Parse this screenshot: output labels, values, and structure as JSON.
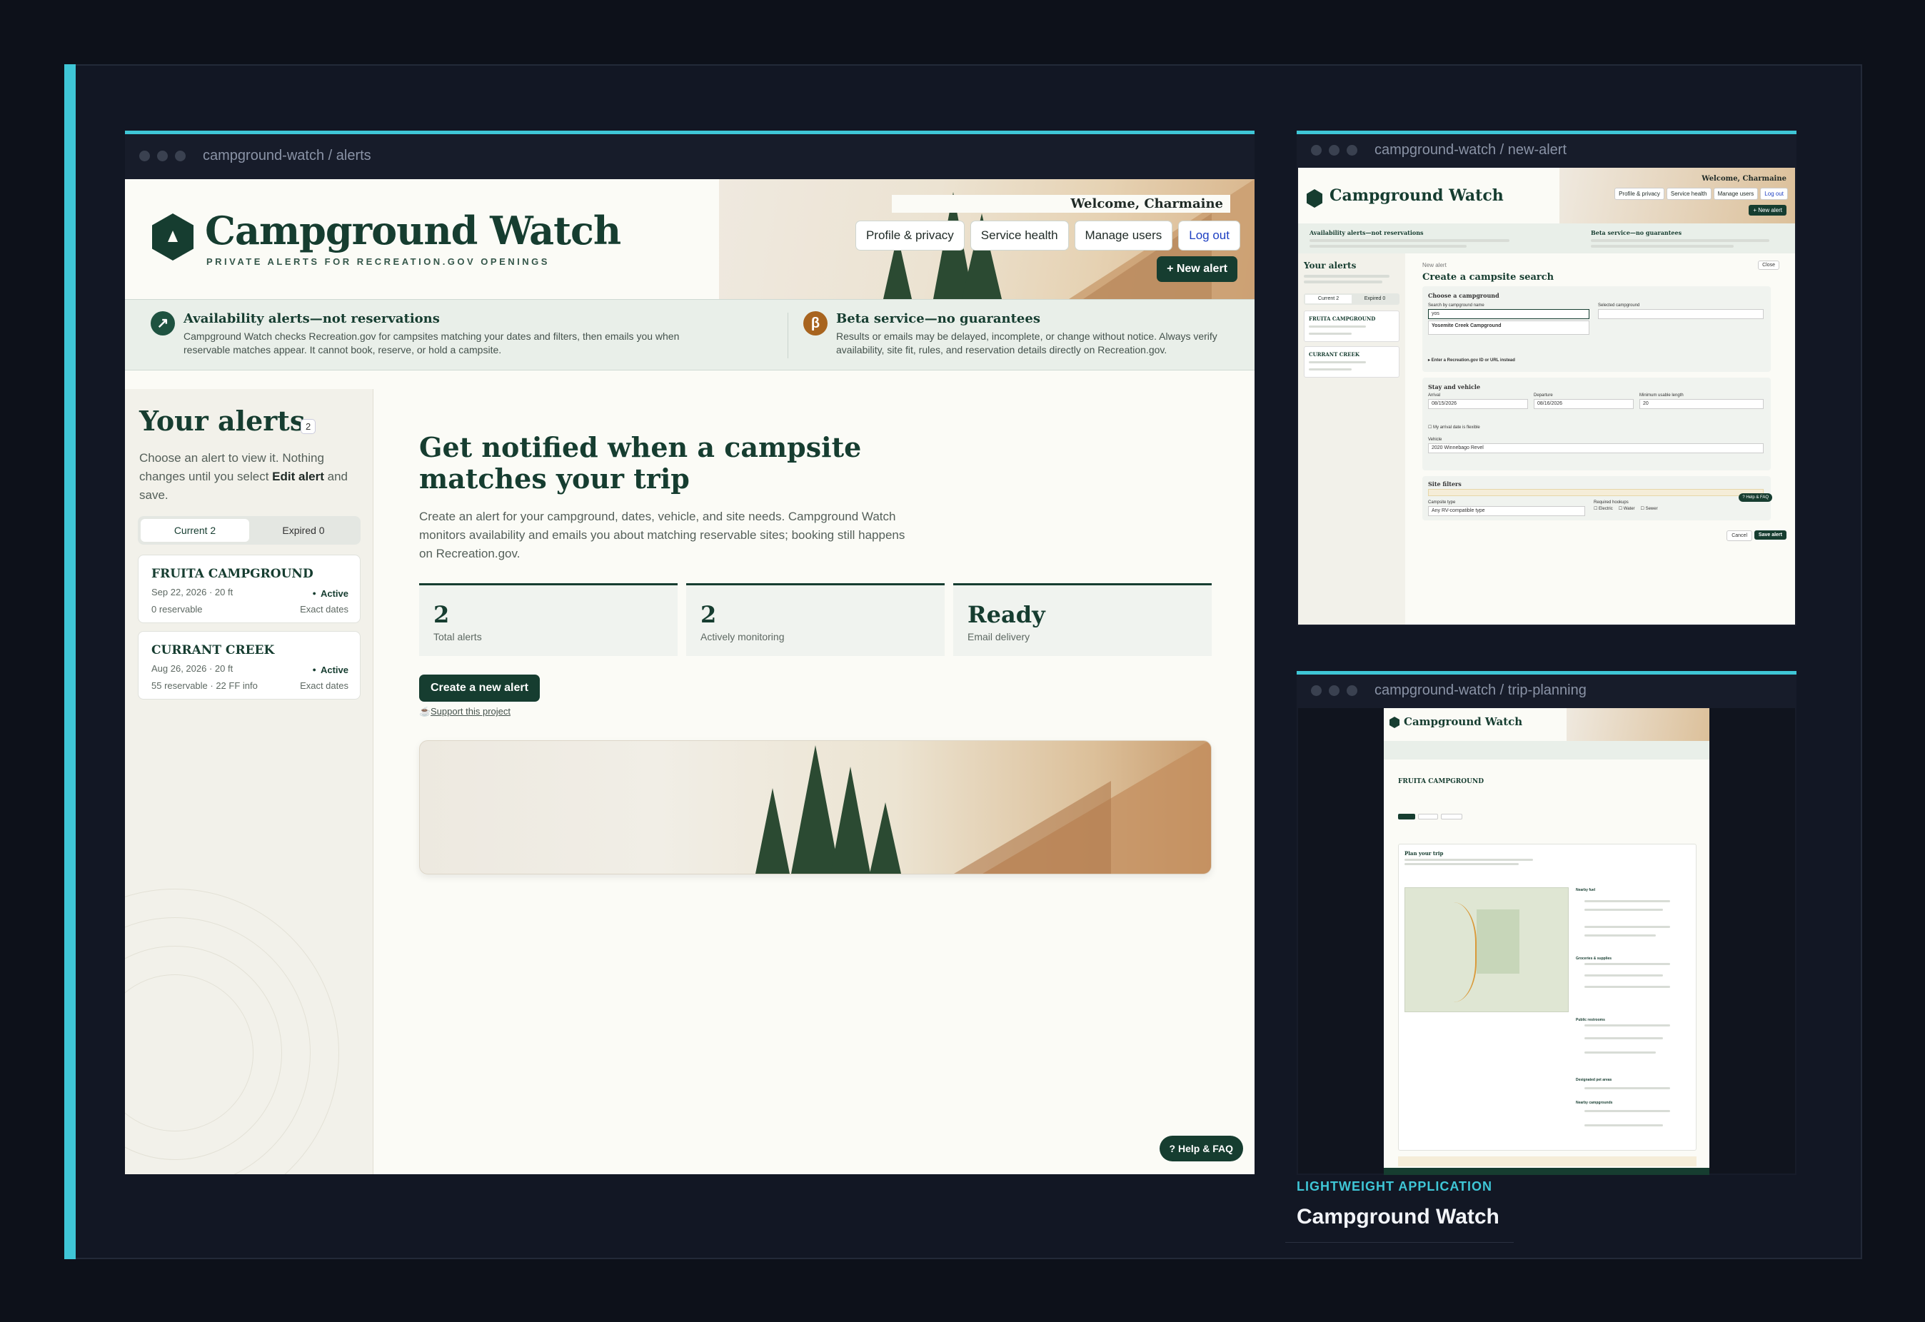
{
  "main_window": {
    "path": "campground-watch / alerts",
    "brand": {
      "title": "Campground Watch",
      "subtitle": "PRIVATE ALERTS FOR RECREATION.GOV OPENINGS"
    },
    "welcome": "Welcome, Charmaine",
    "nav": [
      "Profile & privacy",
      "Service health",
      "Manage users",
      "Log out"
    ],
    "new_alert": "+ New alert",
    "notices": [
      {
        "icon": "↗",
        "title": "Availability alerts—not reservations",
        "text": "Campground Watch checks Recreation.gov for campsites matching your dates and filters, then emails you when reservable matches appear. It cannot book, reserve, or hold a campsite."
      },
      {
        "icon": "β",
        "title": "Beta service—no guarantees",
        "text": "Results or emails may be delayed, incomplete, or change without notice. Always verify availability, site fit, rules, and reservation details directly on Recreation.gov."
      }
    ],
    "sidebar": {
      "title": "Your alerts",
      "count": "2",
      "help_pre": "Choose an alert to view it. Nothing changes until you select ",
      "help_bold": "Edit alert",
      "help_post": " and save.",
      "tabs": [
        "Current 2",
        "Expired 0"
      ],
      "alerts": [
        {
          "name": "FRUITA CAMPGROUND",
          "meta": "Sep 22, 2026 · 20 ft",
          "meta2": "0 reservable",
          "status": "Active",
          "mode": "Exact dates"
        },
        {
          "name": "CURRANT CREEK",
          "meta": "Aug 26, 2026 · 20 ft",
          "meta2": "55 reservable · 22 FF info",
          "status": "Active",
          "mode": "Exact dates"
        }
      ]
    },
    "main": {
      "heading": "Get notified when a campsite matches your trip",
      "lead": "Create an alert for your campground, dates, vehicle, and site needs. Campground Watch monitors availability and emails you about matching reservable sites; booking still happens on Recreation.gov.",
      "stats": [
        {
          "value": "2",
          "label": "Total alerts"
        },
        {
          "value": "2",
          "label": "Actively monitoring"
        },
        {
          "value": "Ready",
          "label": "Email delivery"
        }
      ],
      "create_label": "Create a new alert",
      "support_label": "Support this project",
      "help_label": "? Help & FAQ"
    }
  },
  "new_alert_window": {
    "path": "campground-watch / new-alert",
    "brand": "Campground Watch",
    "welcome": "Welcome, Charmaine",
    "nav": [
      "Profile & privacy",
      "Service health",
      "Manage users",
      "Log out"
    ],
    "new_alert": "+ New alert",
    "notice1": "Availability alerts—not reservations",
    "notice2": "Beta service—no guarantees",
    "sidebar_title": "Your alerts",
    "tabs": [
      "Current 2",
      "Expired 0"
    ],
    "alerts": [
      "FRUITA CAMPGROUND",
      "CURRANT CREEK"
    ],
    "form": {
      "kicker": "New alert",
      "title": "Create a campsite search",
      "close": "Close",
      "section1": "Choose a campground",
      "search_label": "Search by campground name",
      "search_value": "yos",
      "suggestion": "Yosemite Creek Campground",
      "selected_label": "Selected campground",
      "alt_link": "▸ Enter a Recreation.gov ID or URL instead",
      "section2": "Stay and vehicle",
      "arrival_label": "Arrival",
      "arrival": "08/15/2026",
      "departure_label": "Departure",
      "departure": "08/16/2026",
      "min_len_label": "Minimum usable length",
      "min_len": "20",
      "flexible": "My arrival date is flexible",
      "vehicle_label": "Vehicle",
      "vehicle": "2020 Winnebago Revel",
      "section3": "Site filters",
      "campsite_type_label": "Campsite type",
      "campsite_type": "Any RV-compatible type",
      "hookups_label": "Required hookups",
      "hookups": [
        "Electric",
        "Water",
        "Sewer"
      ],
      "cancel": "Cancel",
      "save": "Save alert",
      "help": "? Help & FAQ"
    }
  },
  "trip_window": {
    "path": "campground-watch / trip-planning",
    "brand": "Campground Watch",
    "campground": "FRUITA CAMPGROUND",
    "plan_title": "Plan your trip",
    "sections": [
      "Nearby fuel",
      "Groceries & supplies",
      "Public restrooms",
      "Designated pet areas",
      "Nearby campgrounds"
    ]
  },
  "caption": {
    "tag": "LIGHTWEIGHT APPLICATION",
    "title": "Campground Watch"
  },
  "colors": {
    "accent": "#3fc6d6",
    "brand": "#163d30",
    "beta": "#a8641f",
    "background": "#0d111a"
  }
}
